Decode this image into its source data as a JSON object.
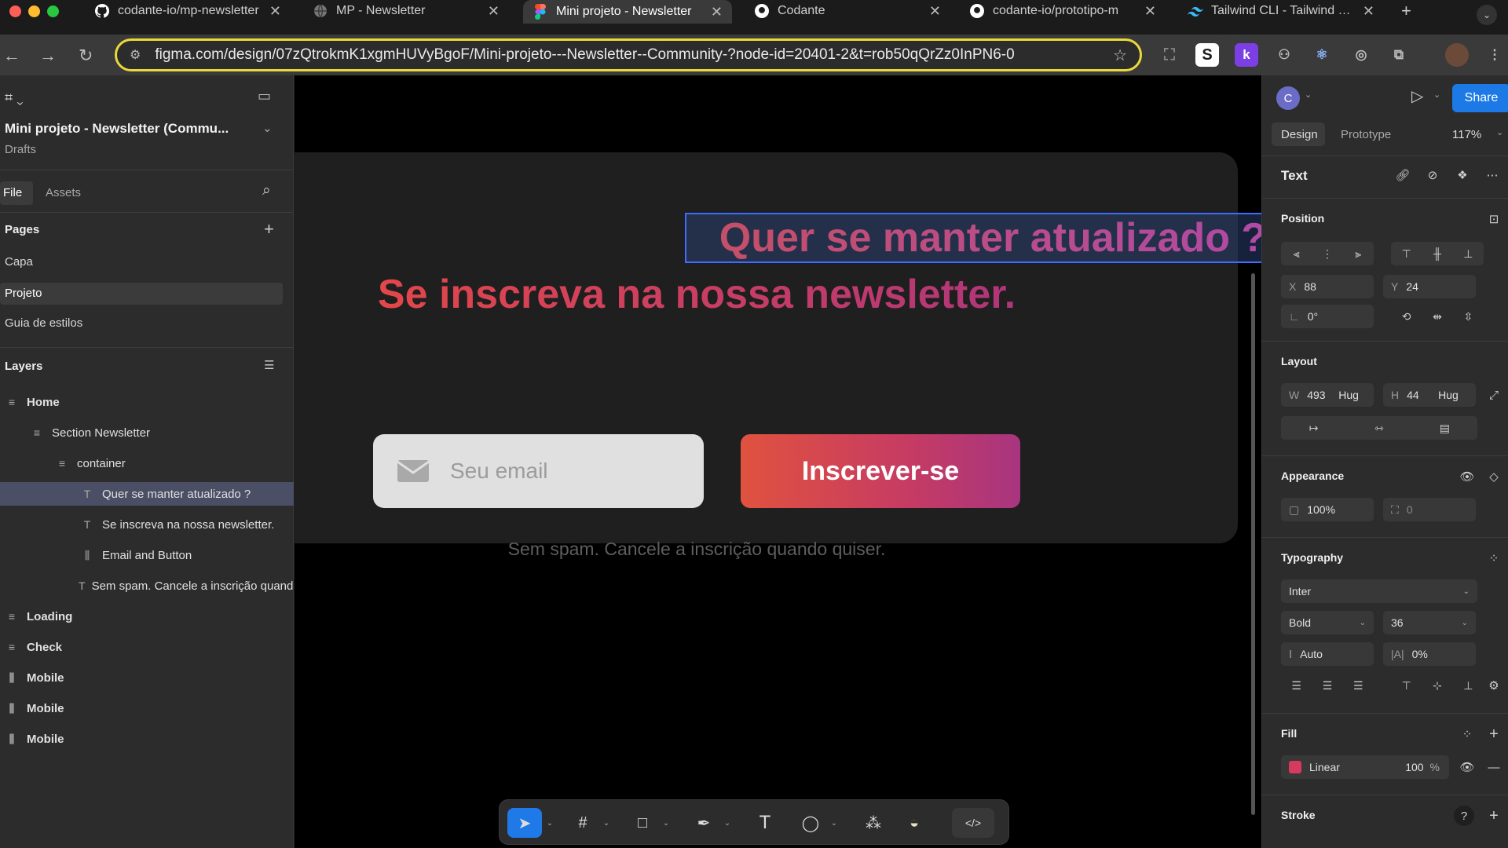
{
  "browser": {
    "tabs": [
      {
        "title": "codante-io/mp-newsletter",
        "icon": "github-icon"
      },
      {
        "title": "MP - Newsletter",
        "icon": "globe-icon"
      },
      {
        "title": "Mini projeto - Newsletter",
        "icon": "figma-icon",
        "active": true
      },
      {
        "title": "Codante",
        "icon": "github-icon"
      },
      {
        "title": "codante-io/prototipo-m",
        "icon": "github-icon"
      },
      {
        "title": "Tailwind CLI - Tailwind CSS",
        "icon": "tailwind-icon"
      }
    ],
    "url": "figma.com/design/07zQtrokmK1xgmHUVyBgoF/Mini-projeto---Newsletter--Community-?node-id=20401-2&t=rob50qQrZz0InPN6-0",
    "ext_k": "k",
    "ext_s": "S"
  },
  "file": {
    "name": "Mini projeto - Newsletter (Commu...",
    "location": "Drafts",
    "tab_file": "File",
    "tab_assets": "Assets"
  },
  "pages": {
    "title": "Pages",
    "items": [
      "Capa",
      "Projeto",
      "Guia de estilos"
    ]
  },
  "layers": {
    "title": "Layers",
    "items": [
      {
        "label": "Home",
        "icon": "≡",
        "bold": true
      },
      {
        "label": "Section Newsletter",
        "icon": "≡"
      },
      {
        "label": "container",
        "icon": "≡"
      },
      {
        "label": "Quer se manter atualizado ?",
        "icon": "T",
        "selected": true
      },
      {
        "label": "Se inscreva na nossa newsletter.",
        "icon": "T"
      },
      {
        "label": "Email and Button",
        "icon": "⫼"
      },
      {
        "label": "Sem spam. Cancele a inscrição quando quiser.",
        "icon": "T"
      },
      {
        "label": "Loading",
        "icon": "≡",
        "bold": true
      },
      {
        "label": "Check",
        "icon": "≡",
        "bold": true
      },
      {
        "label": "Mobile",
        "icon": "⫼",
        "bold": true
      },
      {
        "label": "Mobile",
        "icon": "⫼",
        "bold": true
      },
      {
        "label": "Mobile",
        "icon": "⫼",
        "bold": true
      }
    ]
  },
  "canvas": {
    "heading1": "Quer se manter atualizado ?",
    "heading2": "Se inscreva na nossa newsletter.",
    "email_placeholder": "Seu email",
    "button": "Inscrever-se",
    "note": "Sem spam. Cancele a inscrição quando quiser."
  },
  "inspector": {
    "avatar": "C",
    "share": "Share",
    "tab_design": "Design",
    "tab_prototype": "Prototype",
    "zoom": "117%",
    "object_type": "Text",
    "position": {
      "title": "Position",
      "x_label": "X",
      "x": "88",
      "y_label": "Y",
      "y": "24",
      "rotation": "0°"
    },
    "layout": {
      "title": "Layout",
      "w_label": "W",
      "w": "493",
      "w_mode": "Hug",
      "h_label": "H",
      "h": "44",
      "h_mode": "Hug"
    },
    "appearance": {
      "title": "Appearance",
      "opacity": "100%",
      "radius": "0"
    },
    "typography": {
      "title": "Typography",
      "font": "Inter",
      "weight": "Bold",
      "size": "36",
      "line_height": "Auto",
      "letter_spacing": "0%"
    },
    "fill": {
      "title": "Fill",
      "type": "Linear",
      "opacity": "100",
      "unit": "%",
      "swatch": "#d63a5e"
    },
    "stroke": {
      "title": "Stroke"
    }
  }
}
